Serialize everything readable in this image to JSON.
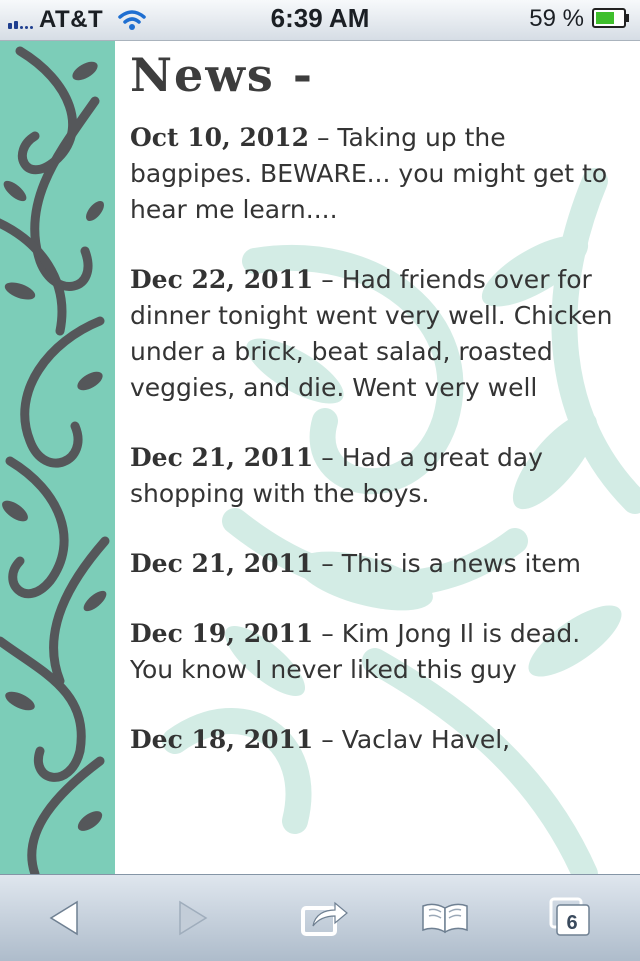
{
  "status_bar": {
    "carrier": "AT&T",
    "time": "6:39 AM",
    "battery_percent": "59 %"
  },
  "page": {
    "heading": "News -",
    "news": [
      {
        "date": "Oct 10, 2012",
        "text": " – Taking up the bagpipes. BEWARE... you might get to hear me learn...."
      },
      {
        "date": "Dec 22, 2011",
        "text": " – Had friends over for dinner tonight went very well. Chicken under a brick, beat salad, roasted veggies, and die. Went very well"
      },
      {
        "date": "Dec 21, 2011",
        "text": " – Had a great day shopping with the boys."
      },
      {
        "date": "Dec 21, 2011",
        "text": " – This is a news item"
      },
      {
        "date": "Dec 19, 2011",
        "text": " – Kim Jong Il is dead. You know I never liked this guy"
      },
      {
        "date": "Dec 18, 2011",
        "text": " – Vaclav Havel,"
      }
    ]
  },
  "toolbar": {
    "tabs_count": "6"
  },
  "colors": {
    "sidebar_teal": "#7ccdb8",
    "swirl_gray": "#55575a",
    "watermark_teal": "#d3ece5"
  }
}
